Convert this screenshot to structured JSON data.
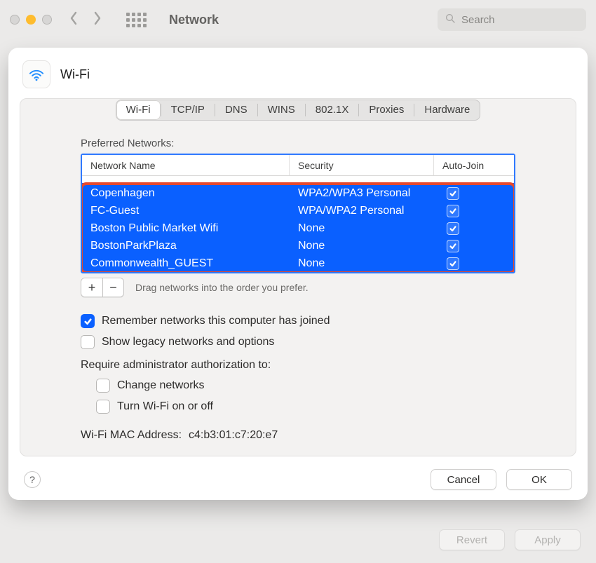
{
  "toolbar": {
    "title": "Network",
    "search_placeholder": "Search"
  },
  "sheet": {
    "title": "Wi-Fi",
    "tabs": [
      "Wi-Fi",
      "TCP/IP",
      "DNS",
      "WINS",
      "802.1X",
      "Proxies",
      "Hardware"
    ],
    "active_tab": 0,
    "preferred_label": "Preferred Networks:",
    "table": {
      "columns": {
        "name": "Network Name",
        "security": "Security",
        "autojoin": "Auto-Join"
      },
      "rows": [
        {
          "name": "Copenhagen",
          "security": "WPA2/WPA3 Personal",
          "autojoin": true
        },
        {
          "name": "FC-Guest",
          "security": "WPA/WPA2 Personal",
          "autojoin": true
        },
        {
          "name": "Boston Public Market Wifi",
          "security": "None",
          "autojoin": true
        },
        {
          "name": "BostonParkPlaza",
          "security": "None",
          "autojoin": true
        },
        {
          "name": "Commonwealth_GUEST",
          "security": "None",
          "autojoin": true
        }
      ]
    },
    "add_label": "+",
    "remove_label": "−",
    "drag_hint": "Drag networks into the order you prefer.",
    "remember_label": "Remember networks this computer has joined",
    "remember_checked": true,
    "legacy_label": "Show legacy networks and options",
    "legacy_checked": false,
    "auth_label": "Require administrator authorization to:",
    "auth_change_label": "Change networks",
    "auth_change_checked": false,
    "auth_wifi_label": "Turn Wi-Fi on or off",
    "auth_wifi_checked": false,
    "mac_label": "Wi-Fi MAC Address:",
    "mac_value": "c4:b3:01:c7:20:e7",
    "help_label": "?",
    "cancel_label": "Cancel",
    "ok_label": "OK"
  },
  "window_buttons": {
    "revert": "Revert",
    "apply": "Apply"
  }
}
